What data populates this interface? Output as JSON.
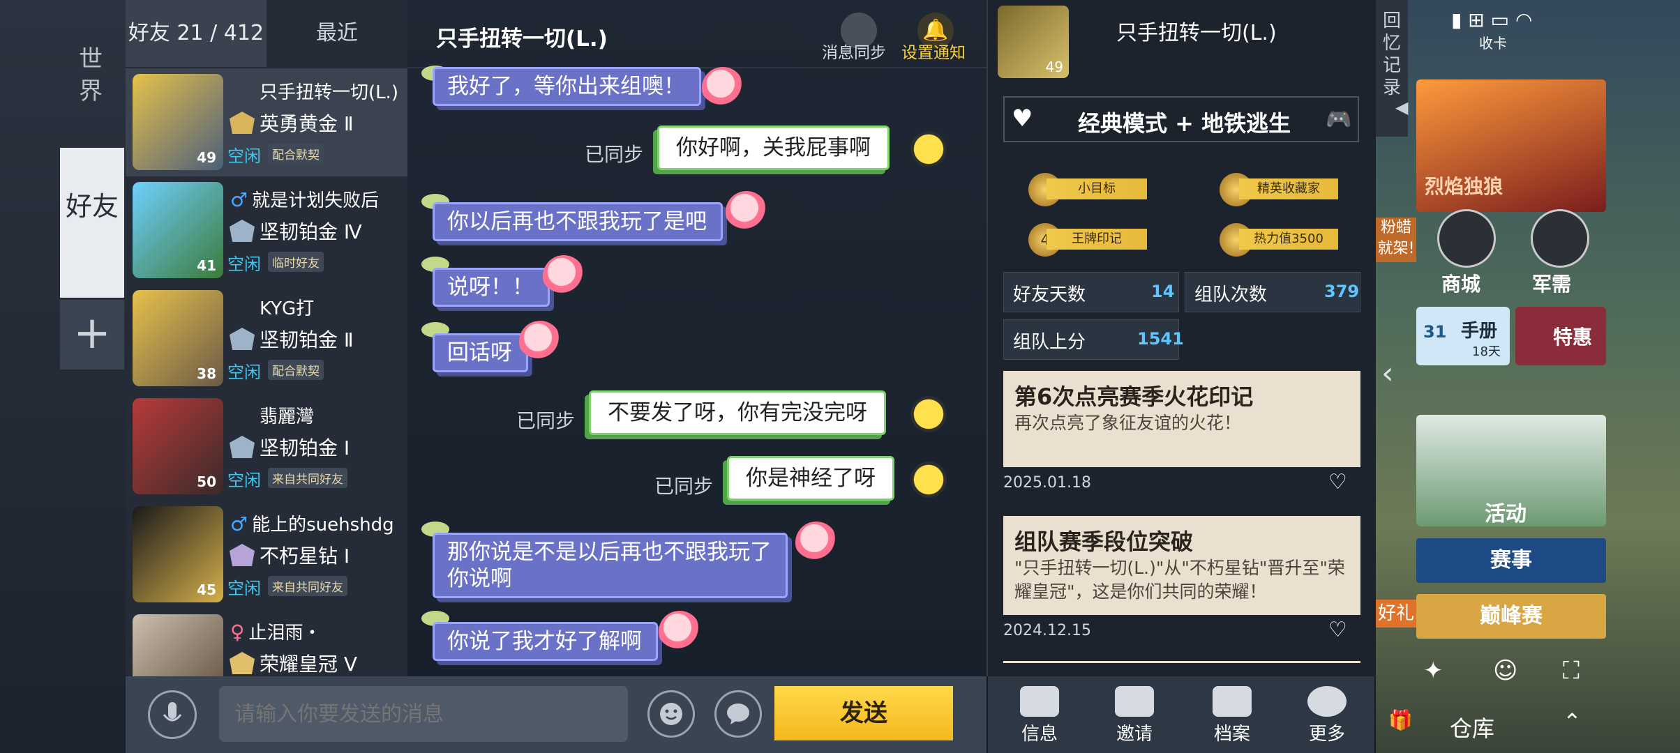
{
  "left_nav": {
    "world": "世界",
    "friends": "好友",
    "add": "+"
  },
  "friend_tabs": {
    "friends": "好友 21 / 412",
    "recent": "最近"
  },
  "friends": [
    {
      "name": "只手扭转一切(L.)",
      "rank": "英勇黄金 Ⅱ",
      "level": "49",
      "status": "空闲",
      "tag": "配合默契",
      "gender": ""
    },
    {
      "name": "就是计划失败后",
      "rank": "坚韧铂金 Ⅳ",
      "level": "41",
      "status": "空闲",
      "tag": "临时好友",
      "gender": "♂"
    },
    {
      "name": "KYG打",
      "rank": "坚韧铂金 Ⅱ",
      "level": "38",
      "status": "空闲",
      "tag": "配合默契",
      "gender": ""
    },
    {
      "name": "翡麗灣",
      "rank": "坚韧铂金 Ⅰ",
      "level": "50",
      "status": "空闲",
      "tag": "来自共同好友",
      "gender": ""
    },
    {
      "name": "能上的suehshdg",
      "rank": "不朽星钻 Ⅰ",
      "level": "45",
      "status": "空闲",
      "tag": "来自共同好友",
      "gender": "♂"
    },
    {
      "name": "止泪雨・",
      "rank": "荣耀皇冠 Ⅴ",
      "level": "",
      "status": "",
      "tag": "",
      "gender": "♀"
    }
  ],
  "chat": {
    "title": "只手扭转一切(L.)",
    "msg_sync": "消息同步",
    "notify": "设置通知",
    "messages": [
      {
        "dir": "in",
        "text": "我好了，等你出来组噢！"
      },
      {
        "dir": "out",
        "text": "你好啊，关我屁事啊",
        "sync": "已同步"
      },
      {
        "dir": "in",
        "text": "你以后再也不跟我玩了是吧"
      },
      {
        "dir": "in",
        "text": "说呀！！"
      },
      {
        "dir": "in",
        "text": "回话呀"
      },
      {
        "dir": "out",
        "text": "不要发了呀，你有完没完呀",
        "sync": "已同步"
      },
      {
        "dir": "out",
        "text": "你是神经了呀",
        "sync": "已同步"
      },
      {
        "dir": "in",
        "text": "那你说是不是以后再也不跟我玩了",
        "text2": "你说啊"
      },
      {
        "dir": "in",
        "text": "你说了我才好了解啊"
      }
    ],
    "input_placeholder": "请输入你要发送的消息",
    "send": "发送"
  },
  "profile": {
    "name": "只手扭转一切(L.)",
    "avatar_level": "49",
    "mode": "经典模式 + 地铁逃生",
    "badges": [
      "小目标",
      "精英收藏家",
      "王牌印记",
      "热力值3500"
    ],
    "badge_small": [
      "4"
    ],
    "stats": [
      {
        "label": "好友天数",
        "value": "14"
      },
      {
        "label": "组队次数",
        "value": "379"
      },
      {
        "label": "组队上分",
        "value": "1541"
      }
    ],
    "cards": [
      {
        "title": "第6次点亮赛季火花印记",
        "desc": "再次点亮了象征友谊的火花！",
        "date": "2025.01.18"
      },
      {
        "title": "组队赛季段位突破",
        "desc": "\"只手扭转一切(L.)\"从\"不朽星钻\"晋升至\"荣耀皇冠\"，这是你们共同的荣耀！",
        "date": "2024.12.15"
      }
    ],
    "bottom": [
      "信息",
      "邀请",
      "档案",
      "更多"
    ]
  },
  "game": {
    "memory": "回忆记录",
    "event_label": "烈焰独狼",
    "shop": "商城",
    "military": "军需",
    "manual": "手册",
    "manual_days": "18天",
    "manual_num": "31",
    "deal": "特惠",
    "activity": "活动",
    "events": "赛事",
    "peak": "巅峰赛",
    "warehouse": "仓库",
    "gift": "好礼",
    "fan_tag": "粉蜡就架!",
    "collect": "收卡"
  },
  "colors": {
    "accent_gold": "#f4b81e",
    "bubble_in": "#6a72c8",
    "bubble_out_border": "#7fd36b",
    "status_idle": "#3cc8f0"
  }
}
